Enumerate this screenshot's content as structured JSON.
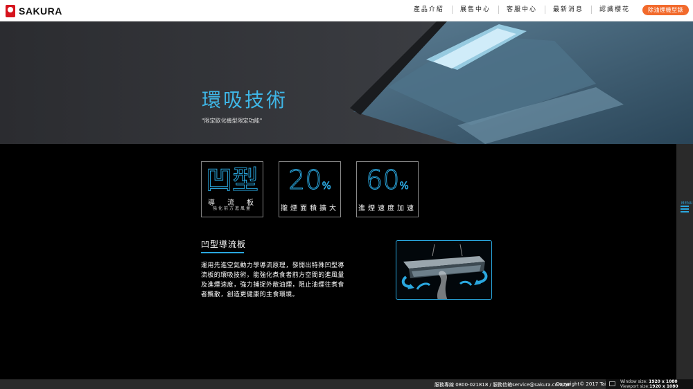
{
  "header": {
    "logo_text": "SAKURA",
    "nav": [
      "產品介紹",
      "展售中心",
      "客服中心",
      "最新消息",
      "認識櫻花"
    ],
    "cta_label": "除油煙機型錄"
  },
  "hero": {
    "title": "環吸技術",
    "subtitle": "\"限定歐化機型限定功能\""
  },
  "features": [
    {
      "big": "凹型",
      "label": "導　流　板",
      "sub": "強化前方進風量"
    },
    {
      "big": "20",
      "unit": "%",
      "label": "攏煙面積擴大"
    },
    {
      "big": "60",
      "unit": "%",
      "label": "進煙速度加速"
    }
  ],
  "article": {
    "title": "凹型導流板",
    "body": "運用先進空氣動力學導流原理，發開出特殊凹型導流板的環吸技術，能強化煮食者前方空間的進風量及進煙速度，強力捕捉外散油煙，阻止油煙往煮食者飄散，創造更健康的主食環境。"
  },
  "side_menu": {
    "label": "MENU"
  },
  "footer": {
    "service": "服務專線 0800-021818 / 服務信箱service@sakura.com.tw",
    "copyright": "Copyright© 2017 Taiwan"
  },
  "window_info": {
    "window_label": "Window size:",
    "window_value": "1920 x 1080",
    "viewport_label": "Viewport size:",
    "viewport_value": "1920 x 1080"
  },
  "colors": {
    "accent": "#2aa8e0",
    "cta": "#f26a2c",
    "brand": "#d6141d"
  }
}
